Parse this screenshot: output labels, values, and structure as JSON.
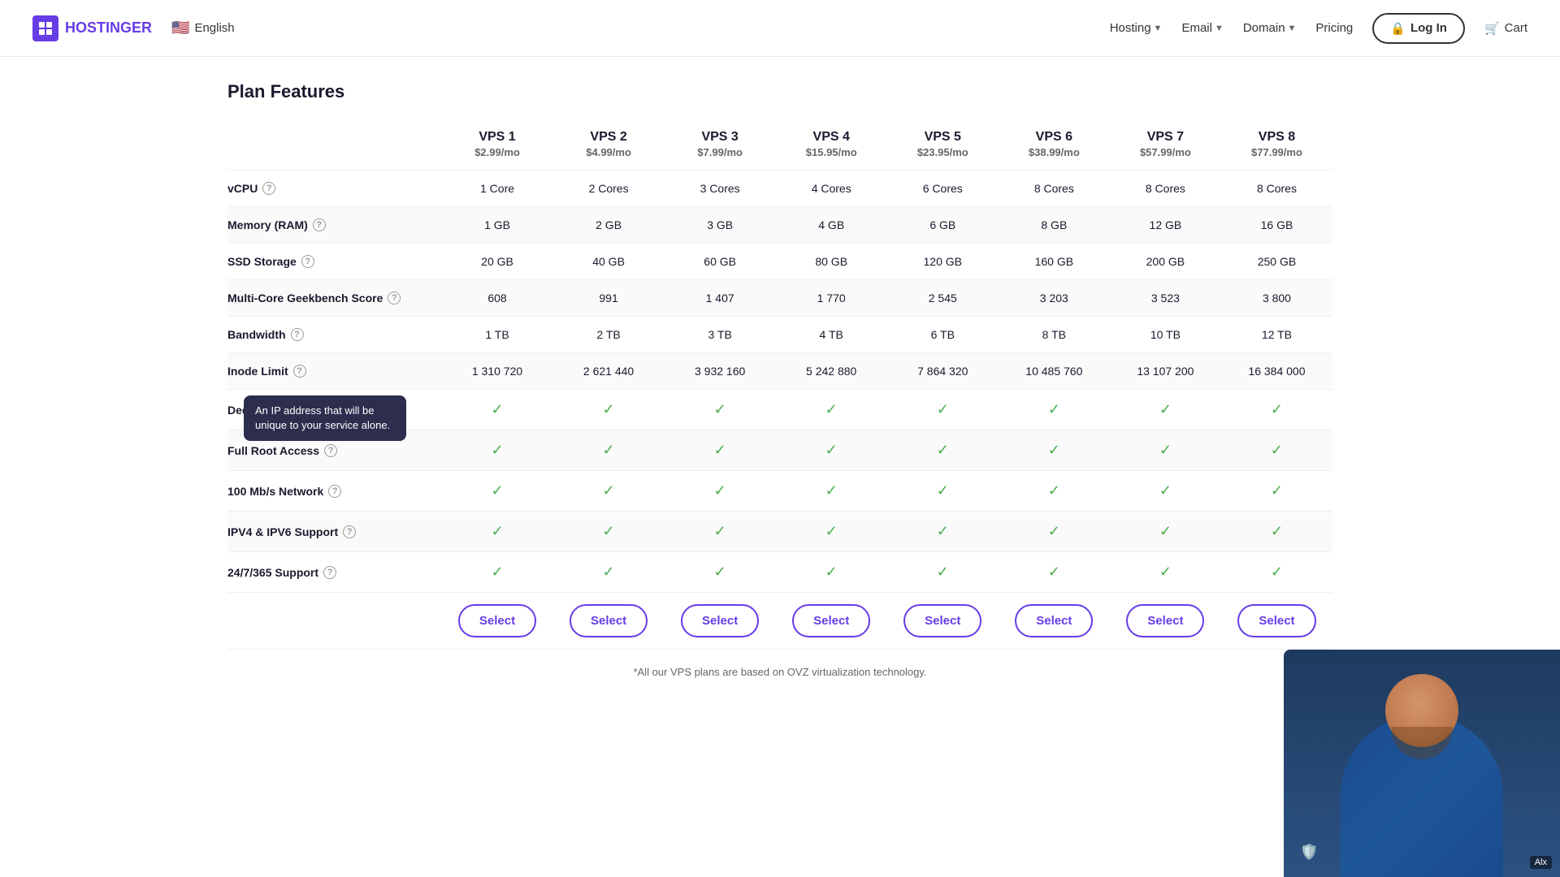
{
  "navbar": {
    "logo_text": "HOSTINGER",
    "language": "English",
    "nav_items": [
      {
        "label": "Hosting",
        "has_dropdown": true
      },
      {
        "label": "Email",
        "has_dropdown": true
      },
      {
        "label": "Domain",
        "has_dropdown": true
      },
      {
        "label": "Pricing",
        "has_dropdown": false
      }
    ],
    "login_label": "Log In",
    "cart_label": "Cart"
  },
  "page": {
    "section_title": "Plan Features",
    "footer_note": "*All our VPS plans are based on OVZ virtualization technology."
  },
  "plans": [
    {
      "name": "VPS 1",
      "price": "$2.99/mo"
    },
    {
      "name": "VPS 2",
      "price": "$4.99/mo"
    },
    {
      "name": "VPS 3",
      "price": "$7.99/mo"
    },
    {
      "name": "VPS 4",
      "price": "$15.95/mo"
    },
    {
      "name": "VPS 5",
      "price": "$23.95/mo"
    },
    {
      "name": "VPS 6",
      "price": "$38.99/mo"
    },
    {
      "name": "VPS 7",
      "price": "$57.99/mo"
    },
    {
      "name": "VPS 8",
      "price": "$77.99/mo"
    }
  ],
  "features": [
    {
      "label": "vCPU",
      "has_info": true,
      "values": [
        "1 Core",
        "2 Cores",
        "3 Cores",
        "4 Cores",
        "6 Cores",
        "8 Cores",
        "8 Cores",
        "8 Cores"
      ]
    },
    {
      "label": "Memory (RAM)",
      "has_info": true,
      "values": [
        "1 GB",
        "2 GB",
        "3 GB",
        "4 GB",
        "6 GB",
        "8 GB",
        "12 GB",
        "16 GB"
      ]
    },
    {
      "label": "SSD Storage",
      "has_info": true,
      "values": [
        "20 GB",
        "40 GB",
        "60 GB",
        "80 GB",
        "120 GB",
        "160 GB",
        "200 GB",
        "250 GB"
      ]
    },
    {
      "label": "Multi-Core Geekbench Score",
      "has_info": true,
      "values": [
        "608",
        "991",
        "1 407",
        "1 770",
        "2 545",
        "3 203",
        "3 523",
        "3 800"
      ]
    },
    {
      "label": "Bandwidth",
      "has_info": true,
      "values": [
        "1 TB",
        "2 TB",
        "3 TB",
        "4 TB",
        "6 TB",
        "8 TB",
        "10 TB",
        "12 TB"
      ]
    },
    {
      "label": "Inode Limit",
      "has_info": true,
      "values": [
        "1 310 720",
        "2 621 440",
        "3 932 160",
        "5 242 880",
        "7 864 320",
        "10 485 760",
        "13 107 200",
        "16 384 000"
      ]
    },
    {
      "label": "Dedicated IP",
      "has_info": true,
      "tooltip": "An IP address that will be unique to your service alone.",
      "values": [
        "check",
        "check",
        "check",
        "check",
        "check",
        "check",
        "check",
        "check"
      ],
      "show_tooltip": true
    },
    {
      "label": "Full Root Access",
      "has_info": true,
      "values": [
        "check",
        "check",
        "check",
        "check",
        "check",
        "check",
        "check",
        "check"
      ]
    },
    {
      "label": "100 Mb/s Network",
      "has_info": true,
      "values": [
        "check",
        "check",
        "check",
        "check",
        "check",
        "check",
        "check",
        "check"
      ]
    },
    {
      "label": "IPV4 & IPV6 Support",
      "has_info": true,
      "values": [
        "check",
        "check",
        "check",
        "check",
        "check",
        "check",
        "check",
        "check"
      ]
    },
    {
      "label": "24/7/365 Support",
      "has_info": true,
      "values": [
        "check",
        "check",
        "check",
        "check",
        "check",
        "check",
        "check",
        "check"
      ]
    }
  ],
  "select_label": "Select",
  "tooltip_text": "An IP address that will be unique to your service alone.",
  "alx_label": "Alx"
}
